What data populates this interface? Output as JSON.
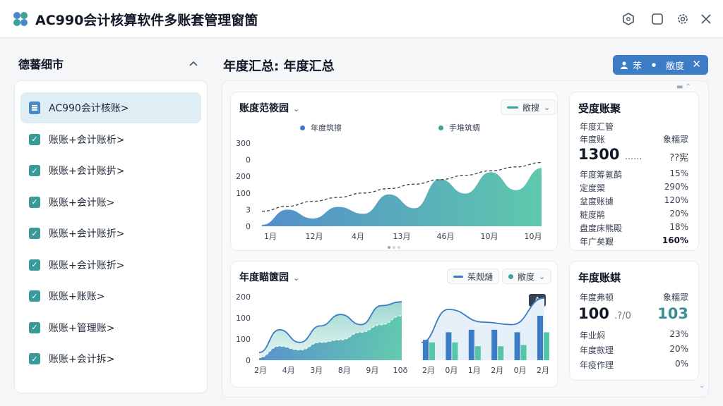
{
  "app": {
    "title": "AC990会计核算软件多账套管理窗箇"
  },
  "sidebar": {
    "title": "德蕃细市",
    "items": [
      {
        "label": "AC990会计核账>",
        "icon": "document-icon",
        "active": true
      },
      {
        "label": "账账+会计账析>",
        "icon": "checkbox-icon"
      },
      {
        "label": "账账+会计账扸>",
        "icon": "checkbox-icon"
      },
      {
        "label": "账账+会计账>",
        "icon": "checkbox-icon"
      },
      {
        "label": "账账+会计账折>",
        "icon": "checkbox-icon"
      },
      {
        "label": "账账+会计账折>",
        "icon": "checkbox-icon"
      },
      {
        "label": "账账+账账>",
        "icon": "checkbox-icon"
      },
      {
        "label": "账账+管理账>",
        "icon": "checkbox-icon"
      },
      {
        "label": "账账+会计拆>",
        "icon": "checkbox-icon"
      }
    ]
  },
  "main": {
    "title": "年度汇总: 年度汇总",
    "filter": {
      "label1": "苯",
      "label2": "●",
      "label3": "敝度"
    }
  },
  "chart1": {
    "title": "账度范筱园",
    "pill": "敝搜",
    "legend": [
      "年度筑擦",
      "手堆筑蜩"
    ],
    "yticks": [
      "300",
      "0",
      "200",
      "100",
      "3",
      "0"
    ],
    "xticks": [
      "1月",
      "12月",
      "4月",
      "13月",
      "46月",
      "10月",
      "10月"
    ]
  },
  "chart2": {
    "title": "年度瞄箧园",
    "pill1": "茱觌熥",
    "pill2": "敝度",
    "badge": "A",
    "yticks": [
      "200",
      "100",
      "100",
      "0"
    ],
    "xticks_left": [
      "2月",
      "4月",
      "3月",
      "8月",
      "9月",
      "10ð"
    ],
    "xticks_right": [
      "2月",
      "0月",
      "1月",
      "2月",
      "0月",
      "2月"
    ]
  },
  "stats1": {
    "title": "受度账聚",
    "sub": "年度汇管",
    "head_k": "年度账",
    "head_v": "象糯眾",
    "big": "1300",
    "big_suffix": "......",
    "big_right": "??宪",
    "rows": [
      {
        "k": "年度筹氪鹋",
        "v": "15%"
      },
      {
        "k": "定度槊",
        "v": "290%"
      },
      {
        "k": "坌度账據",
        "v": "120%"
      },
      {
        "k": "粧度鹃",
        "v": "20%"
      },
      {
        "k": "盘度床熊殿",
        "v": "18%"
      },
      {
        "k": "年广矣艱",
        "v": "160%"
      }
    ]
  },
  "stats2": {
    "title": "年度账蜞",
    "head_k": "年度弗顿",
    "head_v": "象糯眾",
    "big": "100",
    "big_suffix": ".?/0",
    "big_right": "103",
    "rows": [
      {
        "k": "年业焖",
        "v": "23%"
      },
      {
        "k": "年度款理",
        "v": "20%"
      },
      {
        "k": "年疫作理",
        "v": "0%"
      }
    ]
  },
  "chart_data": [
    {
      "type": "area",
      "title": "账度范筱园",
      "categories": [
        "1月",
        "12月",
        "4月",
        "13月",
        "46月",
        "10月",
        "10月"
      ],
      "series": [
        {
          "name": "年度筑擦",
          "values": [
            5,
            60,
            28,
            70,
            45,
            115,
            65,
            170,
            118,
            195,
            130,
            210
          ]
        },
        {
          "name": "手堆筑蜩",
          "values": [
            54,
            72,
            90,
            104,
            120,
            136,
            152,
            168,
            184,
            200,
            214,
            230
          ]
        }
      ]
    },
    {
      "type": "area",
      "title": "年度瞄箧园",
      "categories": [
        "2月",
        "4月",
        "3月",
        "8月",
        "9月",
        "10ð"
      ],
      "series": [
        {
          "values": [
            30,
            120,
            70,
            135,
            180,
            140,
            215,
            230
          ]
        },
        {
          "values": [
            10,
            55,
            40,
            70,
            80,
            110,
            140,
            175
          ]
        }
      ]
    },
    {
      "type": "bar",
      "categories": [
        "2月",
        "0月",
        "1月",
        "2月",
        "0月",
        "2月"
      ],
      "series": [
        {
          "values": [
            80,
            110,
            120,
            120,
            110,
            175
          ]
        },
        {
          "values": [
            70,
            70,
            55,
            55,
            60,
            110
          ]
        }
      ]
    }
  ]
}
